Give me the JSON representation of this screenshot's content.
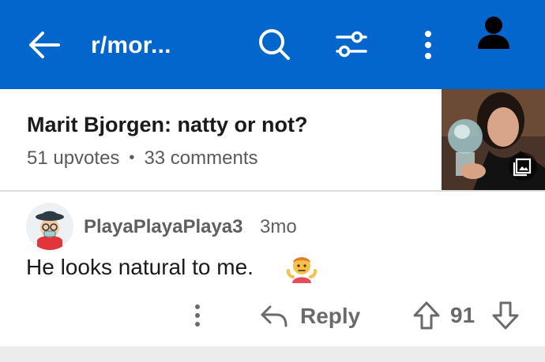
{
  "app_bar": {
    "title": "r/mor...",
    "background_color": "#0266cc",
    "icons": [
      "back-arrow-icon",
      "search-icon",
      "filter-icon",
      "more-vertical-icon",
      "account-icon"
    ]
  },
  "post": {
    "title": "Marit Bjorgen: natty or not?",
    "upvotes": "51 upvotes",
    "separator": "•",
    "comments": "33 comments",
    "thumbnail_badge_icon": "gallery-icon"
  },
  "comment": {
    "username": "PlayaPlayaPlaya3",
    "timestamp": "3mo",
    "body": "He looks natural to me.",
    "emoji": "person-shrugging",
    "actions": {
      "reply_label": "Reply",
      "score": "91"
    }
  }
}
